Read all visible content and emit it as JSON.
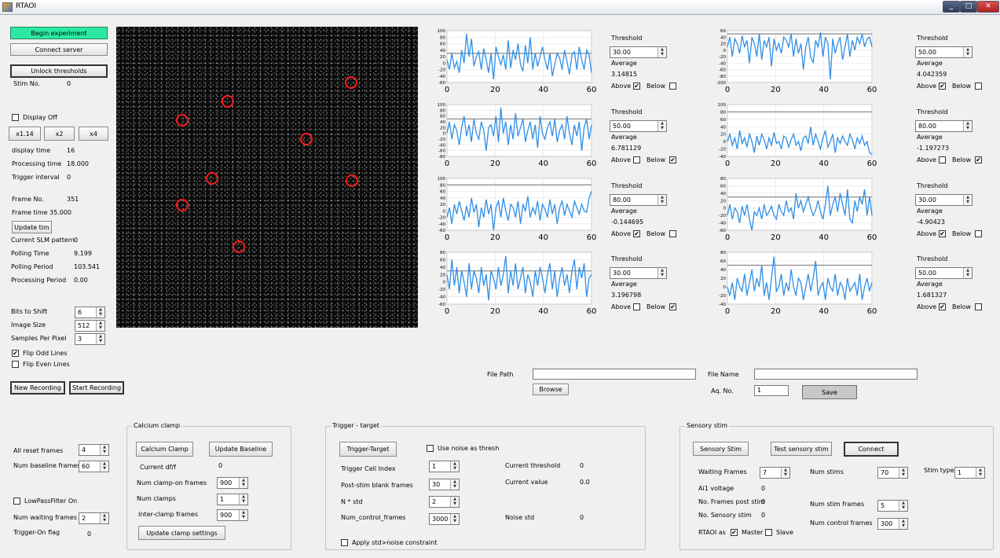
{
  "window": {
    "title": "RTAOI"
  },
  "left_panel": {
    "begin_experiment": "Begin experiment",
    "connect_server": "Connect server",
    "unlock_thresholds": "Unlock thresholds",
    "stim_no_label": "Stim No.",
    "stim_no_value": "0",
    "display_off_label": "Display Off",
    "display_off_checked": false,
    "zoom_buttons": [
      "x1.14",
      "x2",
      "x4"
    ],
    "display_time_label": "display time",
    "display_time_value": "16",
    "processing_time_label": "Processing time",
    "processing_time_value": "18.000",
    "trigger_interval_label": "Trigger interval",
    "trigger_interval_value": "0",
    "frame_no_label": "Frame No.",
    "frame_no_value": "351",
    "frame_time_label": "Frame time",
    "frame_time_value": "35.000",
    "update_tim": "Update tim",
    "current_slm_label": "Current SLM pattern",
    "current_slm_value": "0",
    "polling_time_label": "Polling Time",
    "polling_time_value": "9.199",
    "polling_period_label": "Polling Period",
    "polling_period_value": "103.541",
    "processing_period_label": "Processing Period",
    "processing_period_value": "0.00",
    "bits_to_shift_label": "Bits to Shift",
    "bits_to_shift_value": "6",
    "image_size_label": "Image Size",
    "image_size_value": "512",
    "samples_per_pixel_label": "Samples Per Pixel",
    "samples_per_pixel_value": "3",
    "flip_odd_label": "Flip Odd Lines",
    "flip_odd_checked": true,
    "flip_even_label": "Flip Even Lines",
    "flip_even_checked": false,
    "new_recording": "New Recording",
    "start_recording": "Start Recording"
  },
  "charts": [
    {
      "threshold_label": "Threshold",
      "threshold": "30.00",
      "average_label": "Average",
      "average": "3.14815",
      "above_label": "Above",
      "above": true,
      "below_label": "Below",
      "below": false,
      "chart_data": {
        "type": "line",
        "ylim": [
          -60,
          100
        ],
        "yticks": [
          "100",
          "80",
          "60",
          "40",
          "20",
          "0",
          "-20",
          "-40",
          "-60"
        ],
        "xticks": [
          "0",
          "20",
          "40",
          "60"
        ],
        "xlim": [
          0,
          60
        ],
        "threshold": 30,
        "values": [
          10,
          -20,
          30,
          -15,
          5,
          -30,
          40,
          0,
          90,
          20,
          75,
          -10,
          20,
          35,
          -20,
          45,
          10,
          -30,
          30,
          -50,
          50,
          20,
          -5,
          25,
          -20,
          70,
          -15,
          40,
          10,
          60,
          -5,
          -25,
          55,
          0,
          80,
          -20,
          30,
          -10,
          20,
          50,
          10,
          -20,
          30,
          -40,
          -5,
          30,
          15,
          -20,
          40,
          5,
          -35,
          25,
          35,
          -20,
          50,
          10,
          -20,
          40,
          25,
          -30
        ]
      }
    },
    {
      "threshold_label": "Threshold",
      "threshold": "50.00",
      "average_label": "Average",
      "average": "4.042359",
      "above_label": "Above",
      "above": true,
      "below_label": "Below",
      "below": false,
      "chart_data": {
        "type": "line",
        "ylim": [
          -100,
          60
        ],
        "yticks": [
          "60",
          "40",
          "20",
          "0",
          "-20",
          "-40",
          "-60",
          "-80",
          "-100"
        ],
        "xticks": [
          "0",
          "20",
          "40",
          "60"
        ],
        "xlim": [
          0,
          60
        ],
        "threshold": 50,
        "values": [
          10,
          40,
          -20,
          35,
          20,
          -10,
          45,
          10,
          30,
          -40,
          40,
          20,
          -20,
          50,
          -30,
          30,
          10,
          40,
          -50,
          35,
          0,
          20,
          -10,
          40,
          30,
          10,
          50,
          -20,
          35,
          -10,
          20,
          -60,
          10,
          40,
          -20,
          -40,
          30,
          10,
          55,
          -20,
          40,
          20,
          -90,
          35,
          -10,
          20,
          40,
          -30,
          10,
          50,
          -20,
          30,
          0,
          40,
          20,
          50,
          10,
          35,
          40,
          10
        ]
      }
    },
    {
      "threshold_label": "Threshold",
      "threshold": "50.00",
      "average_label": "Average",
      "average": "6.781129",
      "above_label": "Above",
      "above": false,
      "below_label": "Below",
      "below": true,
      "chart_data": {
        "type": "line",
        "ylim": [
          -80,
          100
        ],
        "yticks": [
          "100",
          "80",
          "60",
          "40",
          "20",
          "0",
          "-20",
          "-40",
          "-60",
          "-80"
        ],
        "xticks": [
          "0",
          "20",
          "40",
          "60"
        ],
        "xlim": [
          0,
          60
        ],
        "threshold": 50,
        "values": [
          0,
          40,
          -20,
          30,
          10,
          -40,
          20,
          60,
          -10,
          30,
          -30,
          50,
          0,
          -20,
          40,
          10,
          -60,
          20,
          30,
          -10,
          60,
          -30,
          90,
          0,
          40,
          -40,
          30,
          -20,
          70,
          -10,
          20,
          50,
          -30,
          10,
          40,
          -20,
          30,
          -50,
          60,
          0,
          -20,
          20,
          40,
          -10,
          50,
          -30,
          10,
          30,
          -20,
          60,
          0,
          -40,
          30,
          -10,
          40,
          -60,
          20,
          50,
          -20,
          30
        ]
      }
    },
    {
      "threshold_label": "Threshold",
      "threshold": "80.00",
      "average_label": "Average",
      "average": "-1.197273",
      "above_label": "Above",
      "above": false,
      "below_label": "Below",
      "below": true,
      "chart_data": {
        "type": "line",
        "ylim": [
          -40,
          100
        ],
        "yticks": [
          "100",
          "80",
          "60",
          "40",
          "20",
          "0",
          "-20",
          "-40"
        ],
        "xticks": [
          "0",
          "20",
          "40",
          "60"
        ],
        "xlim": [
          0,
          60
        ],
        "threshold": 80,
        "values": [
          0,
          20,
          -10,
          10,
          -20,
          30,
          -5,
          10,
          -15,
          20,
          0,
          -30,
          15,
          -10,
          20,
          5,
          -20,
          10,
          -10,
          25,
          -5,
          0,
          -20,
          15,
          10,
          -15,
          5,
          20,
          -10,
          0,
          -25,
          10,
          15,
          -5,
          40,
          -10,
          20,
          0,
          -20,
          10,
          30,
          -15,
          0,
          20,
          -30,
          10,
          -5,
          15,
          0,
          -10,
          20,
          5,
          -20,
          10,
          -5,
          15,
          -10,
          0,
          -30,
          -35
        ]
      }
    },
    {
      "threshold_label": "Threshold",
      "threshold": "80.00",
      "average_label": "Average",
      "average": "-0.144695",
      "above_label": "Above",
      "above": true,
      "below_label": "Below",
      "below": false,
      "chart_data": {
        "type": "line",
        "ylim": [
          -60,
          100
        ],
        "yticks": [
          "100",
          "80",
          "60",
          "40",
          "20",
          "0",
          "-20",
          "-40",
          "-60"
        ],
        "xticks": [
          "0",
          "20",
          "40",
          "60"
        ],
        "xlim": [
          0,
          60
        ],
        "threshold": 80,
        "values": [
          -20,
          10,
          -40,
          20,
          -10,
          30,
          0,
          -30,
          15,
          -20,
          40,
          -5,
          20,
          -50,
          10,
          -20,
          35,
          -10,
          20,
          -60,
          10,
          30,
          -20,
          40,
          0,
          -30,
          20,
          10,
          -20,
          30,
          -40,
          20,
          0,
          45,
          -20,
          10,
          -10,
          30,
          -30,
          20,
          5,
          -20,
          35,
          -10,
          20,
          -40,
          10,
          30,
          -15,
          20,
          0,
          -20,
          30,
          10,
          -10,
          20,
          0,
          -5,
          40,
          60
        ]
      }
    },
    {
      "threshold_label": "Threshold",
      "threshold": "30.00",
      "average_label": "Average",
      "average": "-4.90423",
      "above_label": "Above",
      "above": true,
      "below_label": "Below",
      "below": false,
      "chart_data": {
        "type": "line",
        "ylim": [
          -60,
          80
        ],
        "yticks": [
          "80",
          "60",
          "40",
          "20",
          "0",
          "-20",
          "-40",
          "-60"
        ],
        "xticks": [
          "0",
          "20",
          "40",
          "60"
        ],
        "xlim": [
          0,
          60
        ],
        "threshold": 30,
        "values": [
          -20,
          10,
          -30,
          0,
          -10,
          -40,
          5,
          -20,
          10,
          -30,
          -60,
          -10,
          -20,
          0,
          -30,
          10,
          -20,
          -10,
          5,
          -20,
          -30,
          10,
          -10,
          -20,
          20,
          -10,
          0,
          -30,
          40,
          0,
          20,
          -10,
          10,
          30,
          0,
          -20,
          -5,
          20,
          -10,
          -30,
          10,
          60,
          -20,
          10,
          30,
          -10,
          40,
          10,
          -20,
          50,
          -30,
          -40,
          20,
          -10,
          30,
          10,
          50,
          -20,
          30,
          -20
        ]
      }
    },
    {
      "threshold_label": "Threshold",
      "threshold": "30.00",
      "average_label": "Average",
      "average": "3.196798",
      "above_label": "Above",
      "above": false,
      "below_label": "Below",
      "below": true,
      "chart_data": {
        "type": "line",
        "ylim": [
          -60,
          80
        ],
        "yticks": [
          "80",
          "60",
          "40",
          "20",
          "0",
          "-20",
          "-40",
          "-60"
        ],
        "xticks": [
          "0",
          "20",
          "40",
          "60"
        ],
        "xlim": [
          0,
          60
        ],
        "threshold": 30,
        "values": [
          20,
          -20,
          60,
          -10,
          40,
          -30,
          30,
          0,
          -40,
          50,
          -20,
          30,
          10,
          -30,
          40,
          -10,
          20,
          -50,
          30,
          10,
          -20,
          40,
          -10,
          20,
          70,
          -30,
          30,
          -10,
          50,
          -20,
          10,
          40,
          -30,
          20,
          0,
          -40,
          30,
          -10,
          40,
          10,
          -30,
          20,
          50,
          -20,
          30,
          -40,
          10,
          40,
          -10,
          20,
          -30,
          30,
          60,
          -20,
          40,
          10,
          50,
          -40,
          10,
          20
        ]
      }
    },
    {
      "threshold_label": "Threshold",
      "threshold": "50.00",
      "average_label": "Average",
      "average": "1.681327",
      "above_label": "Above",
      "above": true,
      "below_label": "Below",
      "below": false,
      "chart_data": {
        "type": "line",
        "ylim": [
          -40,
          80
        ],
        "yticks": [
          "80",
          "60",
          "40",
          "20",
          "0",
          "-20",
          "-40"
        ],
        "xticks": [
          "0",
          "20",
          "40",
          "60"
        ],
        "xlim": [
          0,
          60
        ],
        "threshold": 50,
        "values": [
          0,
          -20,
          10,
          -30,
          20,
          0,
          -10,
          30,
          -20,
          10,
          40,
          -10,
          20,
          0,
          50,
          -20,
          10,
          -30,
          20,
          70,
          -10,
          0,
          30,
          -20,
          10,
          -10,
          40,
          0,
          -20,
          20,
          10,
          -30,
          0,
          30,
          -10,
          20,
          60,
          -20,
          0,
          10,
          -30,
          20,
          0,
          -10,
          30,
          -20,
          10,
          0,
          -30,
          20,
          -10,
          0,
          10,
          -20,
          30,
          -30,
          0,
          20,
          -10,
          10
        ]
      }
    }
  ],
  "file_section": {
    "file_path_label": "File Path",
    "file_path_value": "",
    "browse": "Browse",
    "file_name_label": "File Name",
    "file_name_value": "",
    "aq_no_label": "Aq. No.",
    "aq_no_value": "1",
    "save": "Save"
  },
  "bottom_left": {
    "all_reset_label": "All reset frames",
    "all_reset_value": "4",
    "num_baseline_label": "Num baseline frames",
    "num_baseline_value": "60",
    "lowpass_label": "LowPassFilter On",
    "lowpass_checked": false,
    "num_waiting_label": "Num waiting frames",
    "num_waiting_value": "2",
    "trigger_on_label": "Trigger-On flag",
    "trigger_on_value": "0"
  },
  "calcium_clamp": {
    "title": "Calcium clamp",
    "calcium_clamp_button": "Calcium Clamp",
    "update_baseline_button": "Update Baseline",
    "current_dff_label": "Current df/f",
    "current_dff_value": "0",
    "num_clamp_on_label": "Num clamp-on frames",
    "num_clamp_on_value": "900",
    "num_clamps_label": "Num clamps",
    "num_clamps_value": "1",
    "inter_clamp_label": "Inter-clamp frames",
    "inter_clamp_value": "900",
    "update_clamp_button": "Update clamp settings"
  },
  "trigger_target": {
    "title": "Trigger - target",
    "trigger_button": "Trigger-Target",
    "use_noise_label": "Use noise as thresh",
    "use_noise_checked": false,
    "trigger_cell_label": "Trigger Cell Index",
    "trigger_cell_value": "1",
    "post_stim_label": "Post-stim blank frames",
    "post_stim_value": "30",
    "n_std_label": "N * std",
    "n_std_value": "2",
    "num_control_label": "Num_control_frames",
    "num_control_value": "3000",
    "current_threshold_label": "Current threshold",
    "current_threshold_value": "0",
    "current_value_label": "Current value",
    "current_value_value": "0.0",
    "noise_std_label": "Noise std",
    "noise_std_value": "0",
    "apply_std_label": "Apply std>noise constraint",
    "apply_std_checked": false
  },
  "sensory_stim": {
    "title": "Sensory stim",
    "sensory_stim_button": "Sensory Stim",
    "test_sensory_button": "Test sensory stim",
    "connect_button": "Connect",
    "waiting_frames_label": "Waiting Frames",
    "waiting_frames_value": "7",
    "num_stims_label": "Num stims",
    "num_stims_value": "70",
    "stim_type_label": "Stim type",
    "stim_type_value": "1",
    "ai1_voltage_label": "Ai1 voltage",
    "ai1_voltage_value": "0",
    "no_frames_post_label": "No. Frames post stim",
    "no_frames_post_value": "0",
    "no_sensory_label": "No. Sensory stim",
    "no_sensory_value": "0",
    "num_stim_frames_label": "Num stim frames",
    "num_stim_frames_value": "5",
    "num_control_frames_label": "Num control frames",
    "num_control_frames_value": "300",
    "rtaoi_as_label": "RTAOI as",
    "master_label": "Master",
    "master_checked": true,
    "slave_label": "Slave",
    "slave_checked": false
  },
  "colors": {
    "accent_green": "#2de8a2",
    "line_blue": "#2f8fe8",
    "roi_red": "#ff1a1a",
    "threshold_gray": "#999999"
  }
}
